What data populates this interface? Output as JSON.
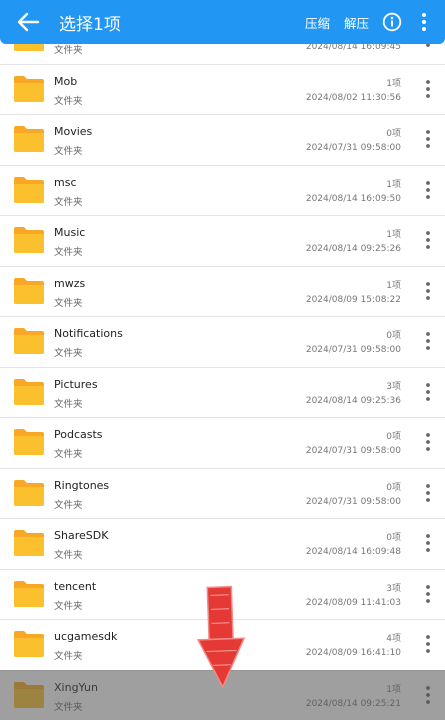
{
  "topbar": {
    "title": "选择1项",
    "compress_label": "压缩",
    "extract_label": "解压"
  },
  "colors": {
    "primary": "#2196F3",
    "folder": "#FBC02D",
    "arrow": "#E53935"
  },
  "files": [
    {
      "name": "",
      "type": "文件夹",
      "count": "",
      "date": "2024/08/14 16:09:45"
    },
    {
      "name": "Mob",
      "type": "文件夹",
      "count": "1项",
      "date": "2024/08/02 11:30:56"
    },
    {
      "name": "Movies",
      "type": "文件夹",
      "count": "0项",
      "date": "2024/07/31 09:58:00"
    },
    {
      "name": "msc",
      "type": "文件夹",
      "count": "1项",
      "date": "2024/08/14 16:09:50"
    },
    {
      "name": "Music",
      "type": "文件夹",
      "count": "1项",
      "date": "2024/08/14 09:25:26"
    },
    {
      "name": "mwzs",
      "type": "文件夹",
      "count": "1项",
      "date": "2024/08/09 15:08:22"
    },
    {
      "name": "Notifications",
      "type": "文件夹",
      "count": "0项",
      "date": "2024/07/31 09:58:00"
    },
    {
      "name": "Pictures",
      "type": "文件夹",
      "count": "3项",
      "date": "2024/08/14 09:25:36"
    },
    {
      "name": "Podcasts",
      "type": "文件夹",
      "count": "0项",
      "date": "2024/07/31 09:58:00"
    },
    {
      "name": "Ringtones",
      "type": "文件夹",
      "count": "0项",
      "date": "2024/07/31 09:58:00"
    },
    {
      "name": "ShareSDK",
      "type": "文件夹",
      "count": "0项",
      "date": "2024/08/14 16:09:48"
    },
    {
      "name": "tencent",
      "type": "文件夹",
      "count": "3项",
      "date": "2024/08/09 11:41:03"
    },
    {
      "name": "ucgamesdk",
      "type": "文件夹",
      "count": "4项",
      "date": "2024/08/09 16:41:10"
    },
    {
      "name": "XingYun",
      "type": "文件夹",
      "count": "1项",
      "date": "2024/08/14 09:25:21"
    }
  ]
}
